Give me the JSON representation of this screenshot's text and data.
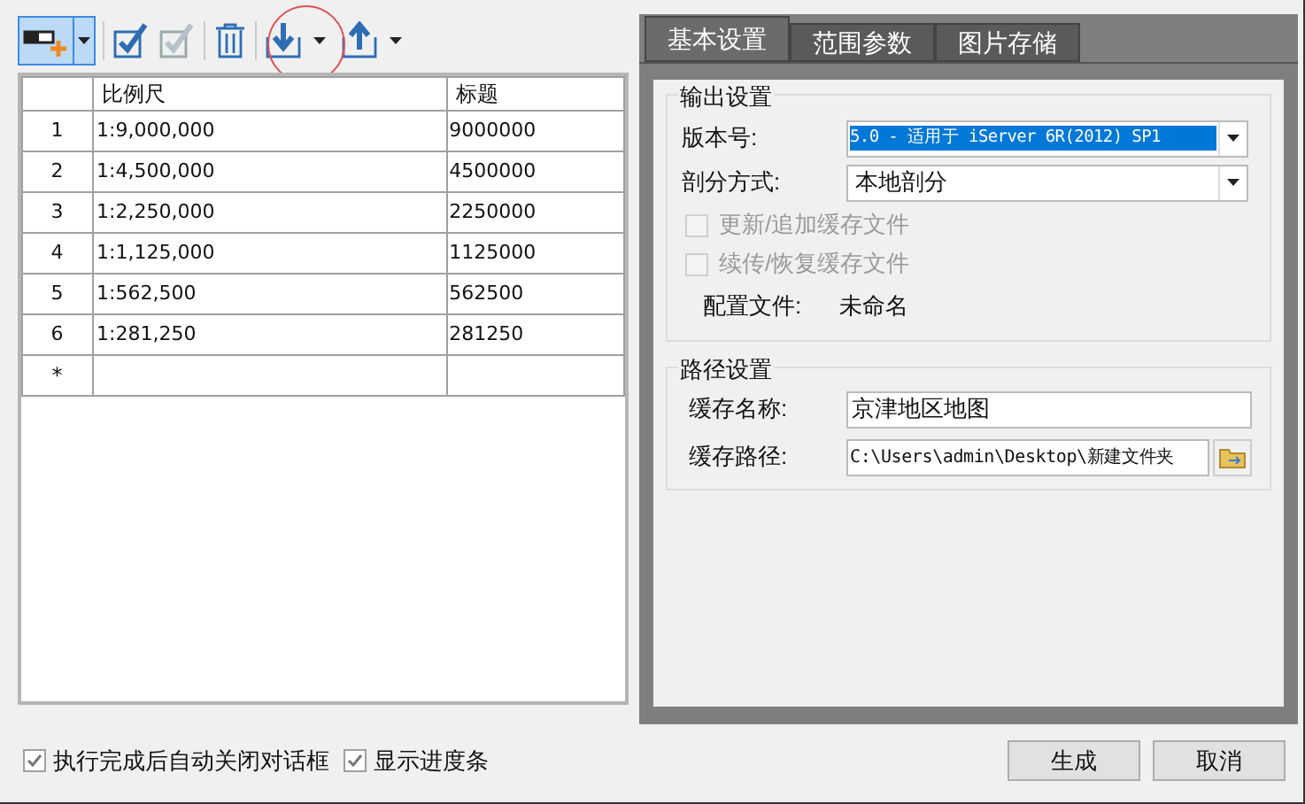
{
  "table": {
    "columns": [
      "比例尺",
      "标题"
    ],
    "rows": [
      {
        "index": "1",
        "scale": "1:9,000,000",
        "title": "9000000"
      },
      {
        "index": "2",
        "scale": "1:4,500,000",
        "title": "4500000"
      },
      {
        "index": "3",
        "scale": "1:2,250,000",
        "title": "2250000"
      },
      {
        "index": "4",
        "scale": "1:1,125,000",
        "title": "1125000"
      },
      {
        "index": "5",
        "scale": "1:562,500",
        "title": "562500"
      },
      {
        "index": "6",
        "scale": "1:281,250",
        "title": "281250"
      }
    ],
    "new_row_marker": "*"
  },
  "tabs": [
    {
      "label": "基本设置",
      "selected": true
    },
    {
      "label": "范围参数",
      "selected": false
    },
    {
      "label": "图片存储",
      "selected": false
    }
  ],
  "output_settings": {
    "title": "输出设置",
    "version_label": "版本号:",
    "version_value": "5.0 - 适用于 iServer 6R(2012) SP1",
    "split_label": "剖分方式:",
    "split_value": "本地剖分",
    "options": [
      {
        "label": "更新/追加缓存文件",
        "checked": false,
        "disabled": true
      },
      {
        "label": "续传/恢复缓存文件",
        "checked": false,
        "disabled": true
      }
    ],
    "config_label": "配置文件:",
    "config_value": "未命名"
  },
  "path_settings": {
    "title": "路径设置",
    "name_label": "缓存名称:",
    "name_value": "京津地区地图",
    "path_label": "缓存路径:",
    "path_value": "C:\\Users\\admin\\Desktop\\新建文件夹"
  },
  "footer": {
    "options": [
      {
        "label": "执行完成后自动关闭对话框",
        "checked": true
      },
      {
        "label": "显示进度条",
        "checked": true
      }
    ],
    "buttons": [
      "生成",
      "取消"
    ]
  }
}
